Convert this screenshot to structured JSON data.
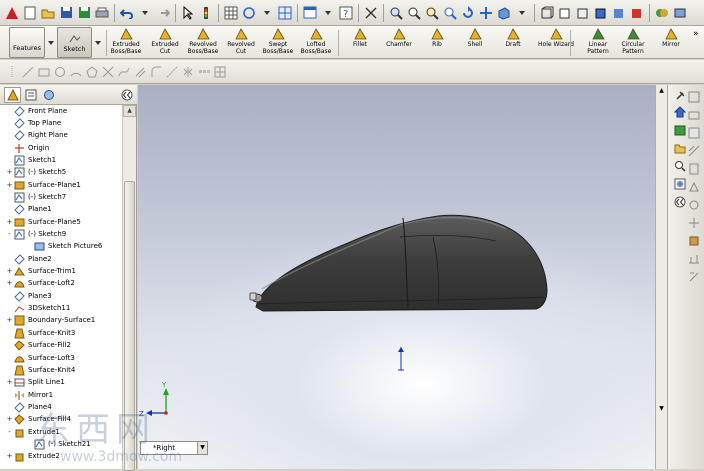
{
  "command_manager": {
    "tabs": [
      {
        "label": "Features"
      },
      {
        "label": "Sketch"
      }
    ],
    "features": [
      {
        "label_1": "Extruded",
        "label_2": "Boss/Base",
        "icon": "extrude-boss-icon"
      },
      {
        "label_1": "Extruded",
        "label_2": "Cut",
        "icon": "extrude-cut-icon"
      },
      {
        "label_1": "Revolved",
        "label_2": "Boss/Base",
        "icon": "revolve-boss-icon"
      },
      {
        "label_1": "Revolved",
        "label_2": "Cut",
        "icon": "revolve-cut-icon"
      },
      {
        "label_1": "Swept",
        "label_2": "Boss/Base",
        "icon": "sweep-icon"
      },
      {
        "label_1": "Lofted",
        "label_2": "Boss/Base",
        "icon": "loft-icon"
      },
      {
        "label_1": "Fillet",
        "label_2": "",
        "icon": "fillet-icon"
      },
      {
        "label_1": "Chamfer",
        "label_2": "",
        "icon": "chamfer-icon"
      },
      {
        "label_1": "Rib",
        "label_2": "",
        "icon": "rib-icon"
      },
      {
        "label_1": "Shell",
        "label_2": "",
        "icon": "shell-icon"
      },
      {
        "label_1": "Draft",
        "label_2": "",
        "icon": "draft-icon"
      },
      {
        "label_1": "Hole Wizard",
        "label_2": "",
        "icon": "hole-wizard-icon"
      },
      {
        "label_1": "Linear",
        "label_2": "Pattern",
        "icon": "linear-pattern-icon"
      },
      {
        "label_1": "Circular",
        "label_2": "Pattern",
        "icon": "circular-pattern-icon"
      },
      {
        "label_1": "Mirror",
        "label_2": "",
        "icon": "mirror-icon"
      }
    ]
  },
  "feature_tree": [
    {
      "label": "Front Plane",
      "icon": "plane-icon",
      "expander": ""
    },
    {
      "label": "Top Plane",
      "icon": "plane-icon",
      "expander": ""
    },
    {
      "label": "Right Plane",
      "icon": "plane-icon",
      "expander": ""
    },
    {
      "label": "Origin",
      "icon": "origin-icon",
      "expander": ""
    },
    {
      "label": "Sketch1",
      "icon": "sketch-icon",
      "expander": ""
    },
    {
      "label": "(-) Sketch5",
      "icon": "sketch-icon",
      "expander": "+"
    },
    {
      "label": "Surface-Plane1",
      "icon": "surface-icon",
      "expander": "+"
    },
    {
      "label": "(-) Sketch7",
      "icon": "sketch-icon",
      "expander": ""
    },
    {
      "label": "Plane1",
      "icon": "plane-icon",
      "expander": ""
    },
    {
      "label": "Surface-Plane5",
      "icon": "surface-icon",
      "expander": "+"
    },
    {
      "label": "(-) Sketch9",
      "icon": "sketch-icon",
      "expander": "-"
    },
    {
      "label": "Sketch Picture6",
      "icon": "picture-icon",
      "expander": "",
      "indent": true
    },
    {
      "label": "Plane2",
      "icon": "plane-icon",
      "expander": ""
    },
    {
      "label": "Surface-Trim1",
      "icon": "surface-trim-icon",
      "expander": "+"
    },
    {
      "label": "Surface-Loft2",
      "icon": "surface-loft-icon",
      "expander": "+"
    },
    {
      "label": "Plane3",
      "icon": "plane-icon",
      "expander": ""
    },
    {
      "label": "3DSketch11",
      "icon": "sketch3d-icon",
      "expander": ""
    },
    {
      "label": "Boundary-Surface1",
      "icon": "boundary-surface-icon",
      "expander": "+"
    },
    {
      "label": "Surface-Knit3",
      "icon": "knit-icon",
      "expander": ""
    },
    {
      "label": "Surface-Fill2",
      "icon": "fill-icon",
      "expander": ""
    },
    {
      "label": "Surface-Loft3",
      "icon": "surface-loft-icon",
      "expander": ""
    },
    {
      "label": "Surface-Knit4",
      "icon": "knit-icon",
      "expander": ""
    },
    {
      "label": "Split Line1",
      "icon": "split-line-icon",
      "expander": "+"
    },
    {
      "label": "Mirror1",
      "icon": "mirror-icon",
      "expander": ""
    },
    {
      "label": "Plane4",
      "icon": "plane-icon",
      "expander": ""
    },
    {
      "label": "Surface-Fill4",
      "icon": "fill-icon",
      "expander": "+"
    },
    {
      "label": "Extrude1",
      "icon": "extrude-boss-icon",
      "expander": "-"
    },
    {
      "label": "(-) Sketch21",
      "icon": "sketch-icon",
      "expander": "",
      "indent": true
    },
    {
      "label": "Extrude2",
      "icon": "extrude-boss-icon",
      "expander": "+"
    }
  ],
  "viewport": {
    "view_name": "*Right",
    "model": "computer-mouse-side-view"
  },
  "triad": {
    "y_label": "Y",
    "z_label": "Z"
  },
  "watermark": {
    "text": "东西网",
    "url": "www.3dmow.com"
  },
  "colors": {
    "accent": "#3a68c8",
    "model": "#454545"
  }
}
